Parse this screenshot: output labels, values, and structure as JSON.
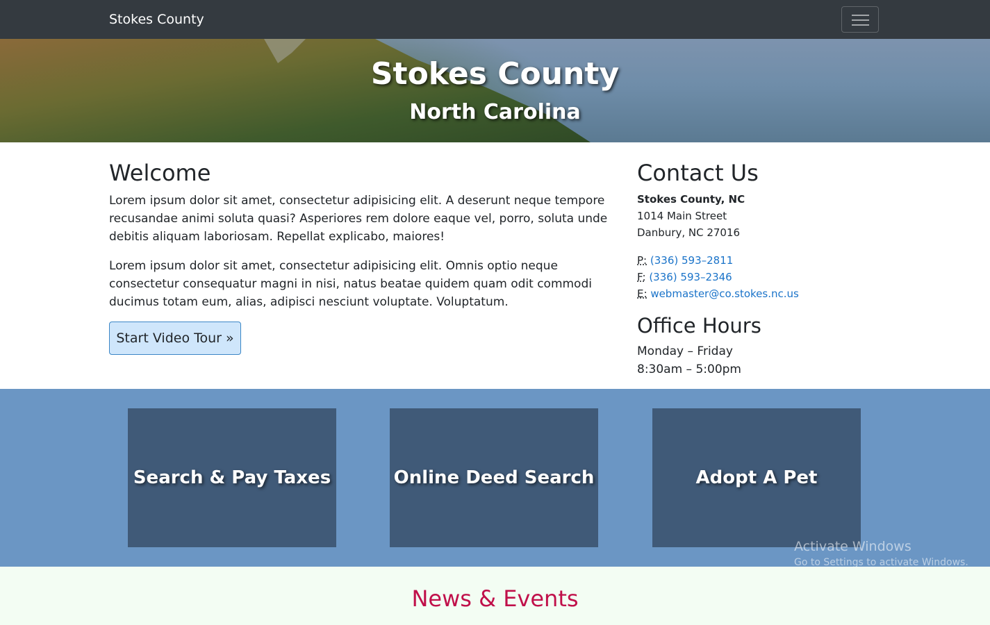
{
  "navbar": {
    "brand": "Stokes County",
    "toggler_icon": "hamburger-icon"
  },
  "hero": {
    "title": "Stokes County",
    "subtitle": "North Carolina"
  },
  "welcome": {
    "heading": "Welcome",
    "paragraph1": "Lorem ipsum dolor sit amet, consectetur adipisicing elit. A deserunt neque tempore recusandae animi soluta quasi? Asperiores rem dolore eaque vel, porro, soluta unde debitis aliquam laboriosam. Repellat explicabo, maiores!",
    "paragraph2": "Lorem ipsum dolor sit amet, consectetur adipisicing elit. Omnis optio neque consectetur consequatur magni in nisi, natus beatae quidem quam odit commodi ducimus totam eum, alias, adipisci nesciunt voluptate. Voluptatum.",
    "button": "Start Video Tour »"
  },
  "contact": {
    "heading": "Contact Us",
    "name": "Stokes County, NC",
    "street": "1014 Main Street",
    "city": "Danbury, NC 27016",
    "phone_label": "P:",
    "phone": "(336) 593–2811",
    "fax_label": "F:",
    "fax": "(336) 593–2346",
    "email_label": "E:",
    "email": "webmaster@co.stokes.nc.us"
  },
  "hours": {
    "heading": "Office Hours",
    "days": "Monday – Friday",
    "time": "8:30am – 5:00pm"
  },
  "tiles": [
    {
      "label": "Search & Pay Taxes"
    },
    {
      "label": "Online Deed Search"
    },
    {
      "label": "Adopt A Pet"
    }
  ],
  "watermark": {
    "line1": "Activate Windows",
    "line2": "Go to Settings to activate Windows."
  },
  "news": {
    "heading": "News & Events"
  },
  "colors": {
    "navbar_bg": "#343a40",
    "tiles_section_bg": "#6b96c4",
    "tile_bg": "#405a78",
    "link": "#1a73c9",
    "news_heading": "#c0104a",
    "news_bg": "#f3fdf3"
  }
}
